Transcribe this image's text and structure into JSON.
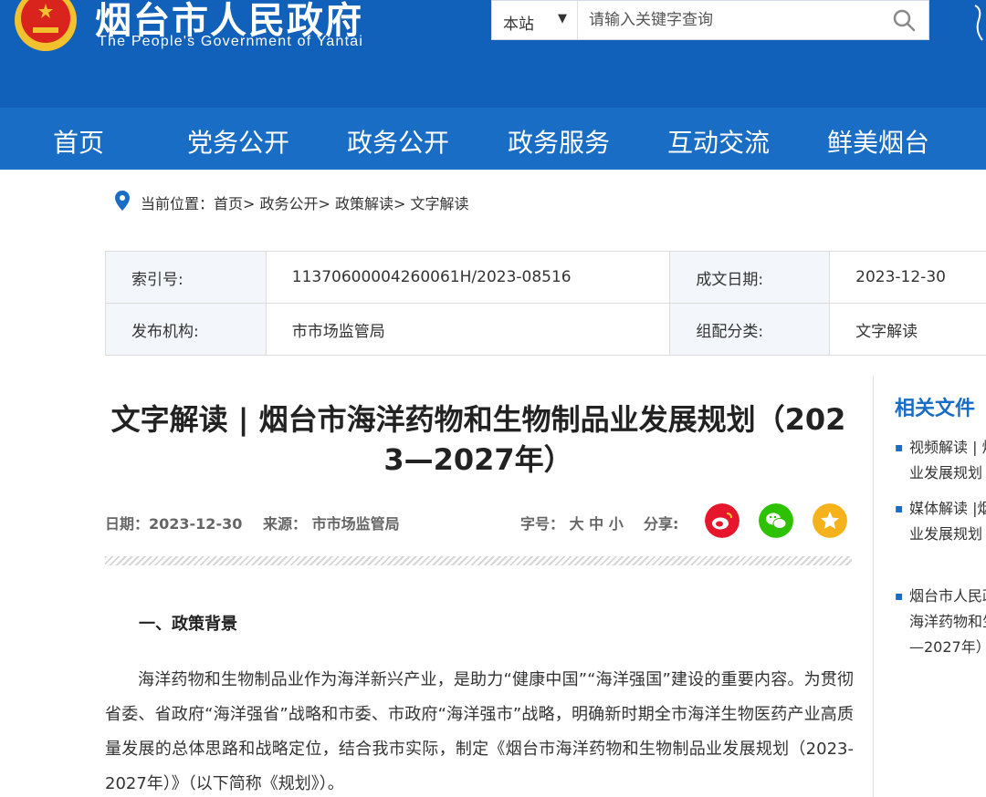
{
  "header": {
    "site_title": "烟台市人民政府",
    "site_subtitle": "The People's Government of Yantai",
    "brand_color": "#1160b9",
    "search": {
      "scope": "本站",
      "placeholder": "请输入关键字查询"
    }
  },
  "nav": {
    "items": [
      "首页",
      "党务公开",
      "政务公开",
      "政务服务",
      "互动交流",
      "鲜美烟台"
    ]
  },
  "breadcrumb": {
    "text": "当前位置：首页> 政务公开> 政策解读> 文字解读"
  },
  "meta": {
    "index_label": "索引号:",
    "index_value": "11370600004260061H/2023-08516",
    "date_label": "成文日期:",
    "date_value": "2023-12-30",
    "publisher_label": "发布机构:",
    "publisher_value": "市市场监管局",
    "category_label": "组配分类:",
    "category_value": "文字解读"
  },
  "article": {
    "title_line1": "文字解读 | 烟台市海洋药物和生物制品业发展规划（202",
    "title_line2": "3—2027年）",
    "date": "日期：2023-12-30",
    "source": "来源： 市市场监管局",
    "font_size_label": "字号： 大 中 小",
    "share_label": "分享:",
    "section_heading": "一、政策背景",
    "paragraph": "海洋药物和生物制品业作为海洋新兴产业，是助力“健康中国”“海洋强国”建设的重要内容。为贯彻省委、省政府“海洋强省”战略和市委、市政府“海洋强市”战略，明确新时期全市海洋生物医药产业高质量发展的总体思路和战略定位，结合我市实际，制定《烟台市海洋药物和生物制品业发展规划（2023-2027年）》（以下简称《规划》）。"
  },
  "share_buttons": [
    {
      "name": "weibo-share-icon",
      "color": "#e6162d"
    },
    {
      "name": "wechat-share-icon",
      "color": "#2dc100"
    },
    {
      "name": "favorite-share-icon",
      "color": "#f6b21b"
    }
  ],
  "sidebar": {
    "title": "相关文件",
    "items": [
      {
        "line1": "视频解读 | 烟",
        "line2": "业发展规划（"
      },
      {
        "line1": "媒体解读 |烟",
        "line2": "业发展规划"
      },
      {
        "line1": "烟台市人民政",
        "line2": "海洋药物和生",
        "line3": "—2027年）"
      }
    ]
  }
}
